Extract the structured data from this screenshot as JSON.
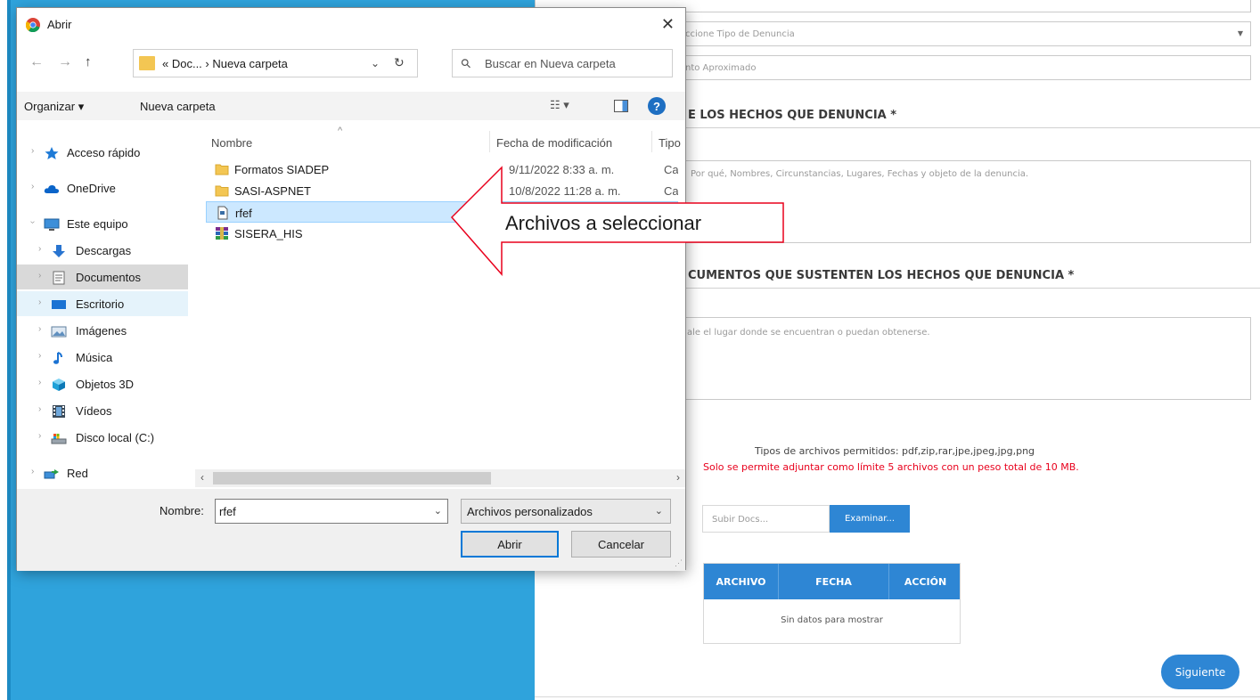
{
  "form": {
    "select_placeholder": "ccione Tipo de Denuncia",
    "amount_placeholder": "nto Aproximado",
    "section_facts_title": "E LOS HECHOS QUE DENUNCIA *",
    "facts_placeholder": "Por qué, Nombres, Circunstancias, Lugares, Fechas y objeto de la denuncia.",
    "section_docs_title": "CUMENTOS QUE SUSTENTEN LOS HECHOS QUE DENUNCIA *",
    "docs_placeholder": "ale el lugar donde se encuentran o puedan obtenerse.",
    "allowed_types": "Tipos de archivos permitidos: pdf,zip,rar,jpe,jpeg,jpg,png",
    "limit_notice": "Solo se permite adjuntar como límite 5 archivos con un peso total de 10 MB.",
    "upload_placeholder": "Subir Docs...",
    "upload_button": "Examinar...",
    "table_headers": [
      "ARCHIVO",
      "FECHA",
      "ACCIÓN"
    ],
    "table_empty": "Sin datos para mostrar",
    "next_button": "Siguiente",
    "accent_color": "#2e86d4",
    "notice_color": "#e8001c"
  },
  "dialog": {
    "title": "Abrir",
    "close_glyph": "✕",
    "address": "« Doc... › Nueva carpeta",
    "search_placeholder": "Buscar en Nueva carpeta",
    "toolbar": {
      "organize": "Organizar ▾",
      "new_folder": "Nueva carpeta"
    },
    "nav_items": [
      {
        "label": "Acceso rápido",
        "icon": "star-icon"
      },
      {
        "label": "OneDrive",
        "icon": "cloud-icon"
      },
      {
        "label": "Este equipo",
        "icon": "computer-icon"
      },
      {
        "label": "Descargas",
        "icon": "download-icon"
      },
      {
        "label": "Documentos",
        "icon": "document-icon"
      },
      {
        "label": "Escritorio",
        "icon": "desktop-icon"
      },
      {
        "label": "Imágenes",
        "icon": "pictures-icon"
      },
      {
        "label": "Música",
        "icon": "music-icon"
      },
      {
        "label": "Objetos 3D",
        "icon": "cube-icon"
      },
      {
        "label": "Vídeos",
        "icon": "video-icon"
      },
      {
        "label": "Disco local (C:)",
        "icon": "drive-icon"
      },
      {
        "label": "Red",
        "icon": "network-icon"
      }
    ],
    "columns": [
      "Nombre",
      "Fecha de modificación",
      "Tipo"
    ],
    "files": [
      {
        "name": "Formatos SIADEP",
        "date": "9/11/2022 8:33 a. m.",
        "type": "Carpeta",
        "icon": "folder-icon"
      },
      {
        "name": "SASI-ASPNET",
        "date": "10/8/2022 11:28 a. m.",
        "type": "Carpeta",
        "icon": "folder-icon"
      },
      {
        "name": "rfef",
        "date": "",
        "type": "",
        "icon": "file-icon"
      },
      {
        "name": "SISERA_HIS",
        "date": "",
        "type": "",
        "icon": "archive-icon"
      }
    ],
    "file_name_label": "Nombre:",
    "file_name_value": "rfef",
    "file_type": "Archivos personalizados",
    "open_button": "Abrir",
    "cancel_button": "Cancelar"
  },
  "annotation": {
    "text": "Archivos a seleccionar",
    "color": "#e8001c"
  }
}
